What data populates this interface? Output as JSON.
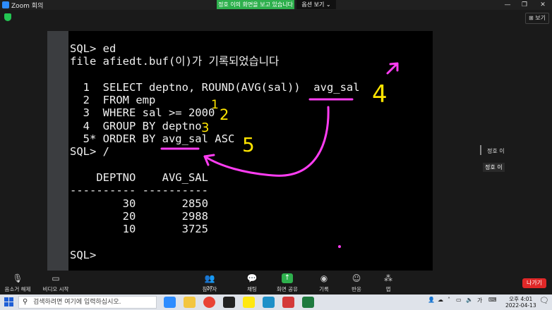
{
  "window": {
    "title": "Zoom 회의",
    "minimize": "—",
    "restore": "❐",
    "close": "✕"
  },
  "share_banner": "정호 이의 화면을 보고 있습니다",
  "view_options": "옵션 보기 ⌄",
  "view_button": "⊞ 보기",
  "console": {
    "lines": [
      "SQL> ed",
      "file afiedt.buf(이)가 기록되었습니다",
      "",
      "  1  SELECT deptno, ROUND(AVG(sal))  avg_sal",
      "  2  FROM emp",
      "  3  WHERE sal >= 2000",
      "  4  GROUP BY deptno",
      "  5* ORDER BY avg_sal ASC",
      "SQL> /",
      "",
      "    DEPTNO    AVG_SAL",
      "---------- ----------",
      "        30       2850",
      "        20       2988",
      "        10       3725",
      "",
      "SQL>"
    ]
  },
  "annotations": {
    "numbers": [
      "1",
      "2",
      "3",
      "4",
      "5"
    ],
    "colors": {
      "yellow": "#ffe500",
      "pink": "#ff3df2"
    }
  },
  "participant": {
    "name": "정호 이",
    "label": "정호 이"
  },
  "toolbar": {
    "mute": "음소거 해제",
    "video": "비디오 시작",
    "participants": "참가자",
    "participants_count": "27",
    "chat": "채팅",
    "share": "화면 공유",
    "record": "기록",
    "reactions": "반응",
    "apps": "앱",
    "leave": "나가기"
  },
  "taskbar": {
    "search_placeholder": "검색하려면 여기에 입력하십시오.",
    "ime_lang": "가",
    "time": "오후 4:01",
    "date": "2022-04-13"
  }
}
